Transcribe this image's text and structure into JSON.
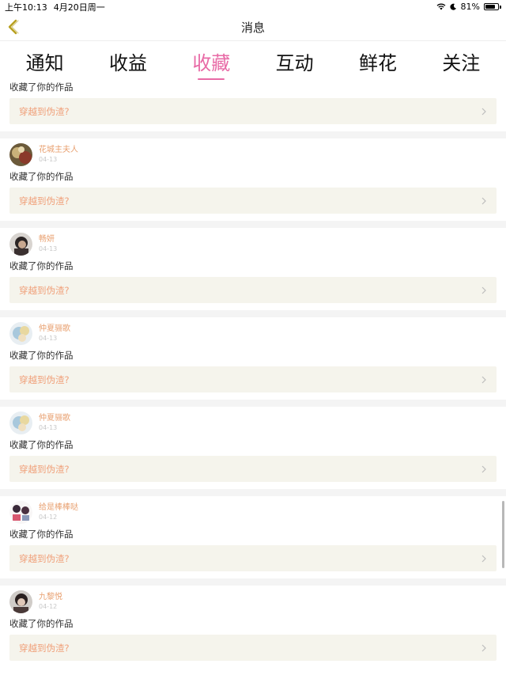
{
  "status_bar": {
    "time": "上午10:13",
    "date": "4月20日周一",
    "battery": "81%",
    "battery_level": 0.81
  },
  "nav": {
    "title": "消息"
  },
  "tabs": [
    {
      "label": "通知",
      "active": false
    },
    {
      "label": "收益",
      "active": false
    },
    {
      "label": "收藏",
      "active": true
    },
    {
      "label": "互动",
      "active": false
    },
    {
      "label": "鲜花",
      "active": false
    },
    {
      "label": "关注",
      "active": false
    }
  ],
  "first_item": {
    "action": "收藏了你的作品",
    "work_title": "穿越到伪渣?"
  },
  "items": [
    {
      "user": "花城主夫人",
      "date": "04-13",
      "action": "收藏了你的作品",
      "work_title": "穿越到伪渣?"
    },
    {
      "user": "畅妍",
      "date": "04-13",
      "action": "收藏了你的作品",
      "work_title": "穿越到伪渣?"
    },
    {
      "user": "仲夏骊歌",
      "date": "04-13",
      "action": "收藏了你的作品",
      "work_title": "穿越到伪渣?"
    },
    {
      "user": "仲夏骊歌",
      "date": "04-13",
      "action": "收藏了你的作品",
      "work_title": "穿越到伪渣?"
    },
    {
      "user": "给是棒棒哒",
      "date": "04-12",
      "action": "收藏了你的作品",
      "work_title": "穿越到伪渣?"
    },
    {
      "user": "九黎悦",
      "date": "04-12",
      "action": "收藏了你的作品",
      "work_title": "穿越到伪渣?"
    }
  ],
  "colors": {
    "accent": "#e86aa6",
    "username": "#e8a070",
    "work_title": "#f0a07a",
    "card_bg": "#f5f4ec",
    "back_arrow": "#b8a020"
  }
}
